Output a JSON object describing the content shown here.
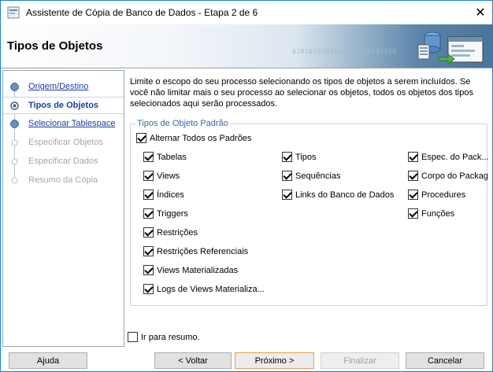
{
  "window": {
    "title": "Assistente de Cópia de Banco de Dados - Etapa 2 de 6",
    "close_symbol": "✕"
  },
  "banner": {
    "heading": "Tipos de Objetos",
    "binary_text": "0101010101010101010101010",
    "logo_icon": "database-copy-icon"
  },
  "nav": {
    "items": [
      {
        "label": "Origem/Destino",
        "state": "link"
      },
      {
        "label": "Tipos de Objetos",
        "state": "active"
      },
      {
        "label": "Selecionar Tablespace",
        "state": "link"
      },
      {
        "label": "Especificar Objetos",
        "state": "disabled"
      },
      {
        "label": "Especificar Dados",
        "state": "disabled"
      },
      {
        "label": "Resumo da Cópia",
        "state": "disabled"
      }
    ]
  },
  "content": {
    "intro": "Limite o escopo do seu processo selecionando os tipos de objetos a serem incluídos. Se você não limitar mais o seu processo ao selecionar os objetos, todos os objetos dos tipos selecionados aqui serão processados.",
    "group_legend": "Tipos de Objeto Padrão",
    "toggle_all": {
      "label": "Alternar Todos os Padrões",
      "checked": true
    },
    "col1": [
      {
        "label": "Tabelas",
        "checked": true
      },
      {
        "label": "Views",
        "checked": true
      },
      {
        "label": "Índices",
        "checked": true
      },
      {
        "label": "Triggers",
        "checked": true
      },
      {
        "label": "Restrições",
        "checked": true
      },
      {
        "label": "Restrições Referenciais",
        "checked": true
      },
      {
        "label": "Views Materializadas",
        "checked": true
      },
      {
        "label": "Logs de Views Materializa...",
        "checked": true
      }
    ],
    "col2": [
      {
        "label": "Tipos",
        "checked": true
      },
      {
        "label": "Sequências",
        "checked": true
      },
      {
        "label": "Links do Banco de Dados",
        "checked": true
      }
    ],
    "col3": [
      {
        "label": "Espec. do Pack...",
        "checked": true
      },
      {
        "label": "Corpo do Packag",
        "checked": true
      },
      {
        "label": "Procedures",
        "checked": true
      },
      {
        "label": "Funções",
        "checked": true
      }
    ],
    "resumo": {
      "label": "Ir para resumo.",
      "checked": false
    }
  },
  "buttons": {
    "help": "Ajuda",
    "back": "< Voltar",
    "next": "Próximo >",
    "finish": "Finalizar",
    "cancel": "Cancelar"
  },
  "colors": {
    "link": "#1b3ea0",
    "legend": "#3568a8",
    "disabled": "#a6a6a6",
    "primary_border": "#e5a050"
  }
}
